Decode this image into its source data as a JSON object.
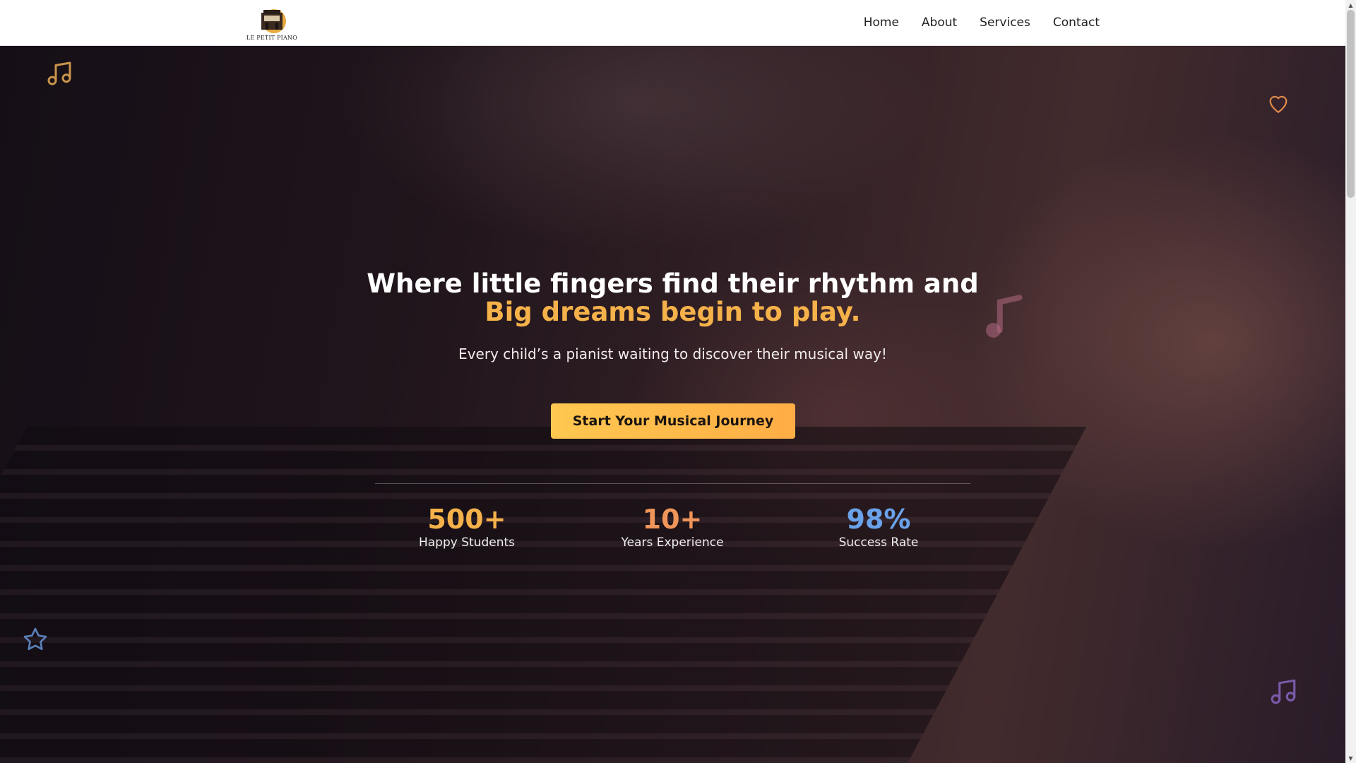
{
  "header": {
    "logo_text": "LE PETIT PIANO",
    "nav": [
      "Home",
      "About",
      "Services",
      "Contact"
    ]
  },
  "hero": {
    "headline_line1": "Where little fingers find their rhythm and",
    "headline_line2": "Big dreams begin to play.",
    "subtitle": "Every child’s a pianist waiting to discover their musical way!",
    "cta_label": "Start Your Musical Journey",
    "stats": [
      {
        "value": "500+",
        "label": "Happy Students",
        "color": "#f5b14a"
      },
      {
        "value": "10+",
        "label": "Years Experience",
        "color": "#f0955a"
      },
      {
        "value": "98%",
        "label": "Success Rate",
        "color": "#6aa2ea"
      }
    ]
  },
  "colors": {
    "accent": "#f5b14a",
    "cta_start": "#ffc850",
    "cta_end": "#ffad45",
    "decor_orange": "#c9944a",
    "decor_blue": "#5b7fb8",
    "decor_purple": "#7a5aa8",
    "decor_pink": "#e07a86"
  },
  "icons": [
    "music-note-icon",
    "heart-icon",
    "star-icon",
    "scroll-up-arrow-icon",
    "scroll-down-arrow-icon"
  ]
}
